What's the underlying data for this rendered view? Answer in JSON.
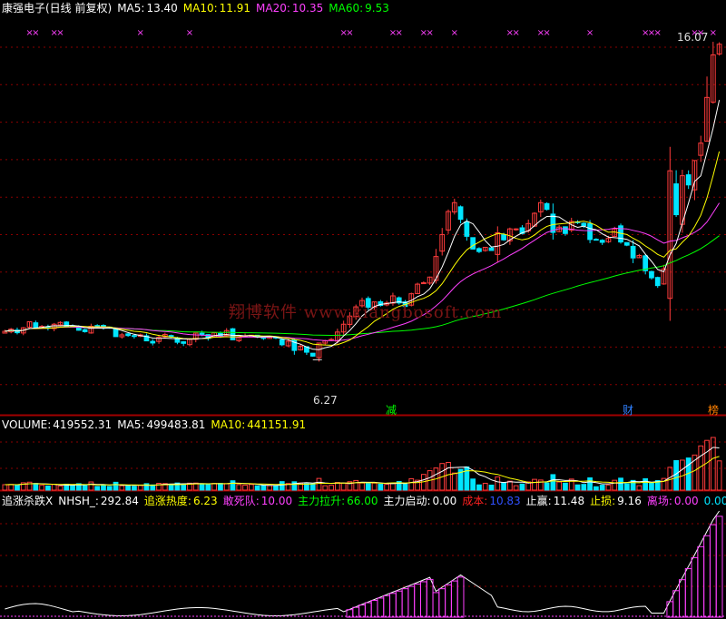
{
  "price_header": {
    "title": "康强电子(日线 前复权)",
    "ma5_label": "MA5:",
    "ma5_value": "13.40",
    "ma10_label": "MA10:",
    "ma10_value": "11.91",
    "ma20_label": "MA20:",
    "ma20_value": "10.35",
    "ma60_label": "MA60:",
    "ma60_value": "9.53"
  },
  "volume_header": {
    "volume_label": "VOLUME:",
    "volume_value": "419552.31",
    "ma5_label": "MA5:",
    "ma5_value": "499483.81",
    "ma10_label": "MA10:",
    "ma10_value": "441151.91"
  },
  "indicator_header": {
    "name": "追涨杀跌X",
    "nhsh_label": "NHSH_:",
    "nhsh_value": "292.84",
    "heat_label": "追涨热度:",
    "heat_value": "6.23",
    "dead_label": "敢死队:",
    "dead_value": "10.00",
    "pull_label": "主力拉升:",
    "pull_value": "66.00",
    "start_label": "主力启动:",
    "start_value": "0.00",
    "cost_label": "成本:",
    "cost_value": "10.83",
    "profit_label": "止赢:",
    "profit_value": "11.48",
    "loss_label": "止损:",
    "loss_value": "9.16",
    "exit_label": "离场:",
    "exit_value": "0.00",
    "extra_value": "0.00"
  },
  "annotations": {
    "high_label": "16.07",
    "low_label": "6.27",
    "tag_jian": "减",
    "tag_cai": "财",
    "tag_bang": "榜"
  },
  "watermark": "翔博软件 www.xiangbosoft.com",
  "colors": {
    "up": "#ff3c3c",
    "down": "#00e5ff",
    "ma5": "#ffffff",
    "ma10": "#ffff00",
    "ma20": "#ff40ff",
    "ma60": "#00ff00",
    "grid": "#8a0000",
    "marker": "#ff40ff"
  },
  "chart_data": {
    "type": "candlestick",
    "price_range": [
      6.0,
      16.5
    ],
    "closes": [
      7.92,
      7.98,
      7.88,
      8.02,
      8.19,
      8.0,
      8.06,
      8.02,
      8.12,
      8.17,
      8.05,
      8.06,
      7.95,
      7.91,
      8.06,
      8.08,
      8.03,
      8.01,
      7.77,
      7.82,
      7.8,
      7.78,
      7.82,
      7.65,
      7.59,
      7.75,
      7.83,
      7.76,
      7.61,
      7.58,
      7.7,
      7.87,
      7.83,
      7.72,
      7.88,
      7.79,
      7.94,
      7.68,
      7.75,
      7.79,
      7.81,
      7.76,
      7.74,
      7.76,
      7.73,
      7.54,
      7.64,
      7.38,
      7.5,
      7.33,
      7.22,
      7.59,
      7.65,
      7.69,
      7.9,
      8.12,
      8.35,
      8.61,
      8.79,
      8.6,
      8.75,
      8.65,
      8.72,
      8.92,
      8.72,
      8.62,
      8.98,
      9.25,
      9.29,
      9.45,
      10.03,
      10.65,
      11.3,
      11.55,
      11.08,
      10.6,
      10.24,
      10.17,
      10.29,
      10.2,
      10.7,
      10.5,
      10.81,
      10.81,
      10.68,
      10.96,
      11.25,
      11.55,
      11.36,
      10.71,
      10.86,
      10.68,
      11.02,
      10.99,
      10.9,
      10.51,
      10.51,
      10.43,
      10.54,
      10.81,
      10.44,
      10.35,
      9.99,
      10.06,
      9.63,
      9.43,
      9.21,
      9.68,
      12.45,
      11.21,
      12.31,
      12.05,
      12.74,
      13.23,
      14.52,
      15.72,
      16.02
    ],
    "ma5_last": 13.4,
    "ma10_last": 11.91,
    "ma20_last": 10.35,
    "ma60_last": 9.53,
    "volume_range": [
      0,
      860000
    ],
    "volume_last": 419552.31,
    "volume_ma5_last": 499483.81,
    "volume_ma10_last": 441151.91,
    "indicator_range": [
      0,
      800
    ]
  }
}
